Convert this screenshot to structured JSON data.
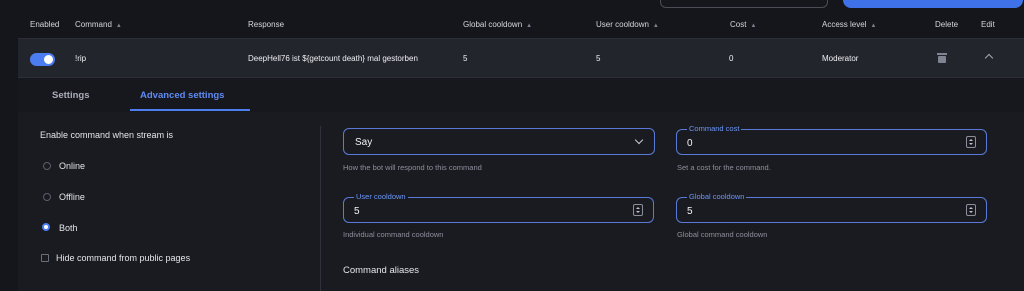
{
  "header": {
    "enabled": "Enabled",
    "command": "Command",
    "response": "Response",
    "global_cooldown": "Global cooldown",
    "user_cooldown": "User cooldown",
    "cost": "Cost",
    "access_level": "Access level",
    "delete": "Delete",
    "edit": "Edit",
    "sort_icon": "▲"
  },
  "row": {
    "enabled": true,
    "command": "!rip",
    "response": "DeepHell76 ist ${getcount death} mal gestorben",
    "global_cooldown": "5",
    "user_cooldown": "5",
    "cost": "0",
    "access_level": "Moderator",
    "delete_icon": "trash-icon",
    "edit_icon": "chevron-up-icon"
  },
  "tabs": {
    "settings": "Settings",
    "advanced": "Advanced settings"
  },
  "advanced": {
    "stream_status_label": "Enable command when stream is",
    "options": [
      {
        "label": "Online",
        "selected": false
      },
      {
        "label": "Offline",
        "selected": false
      },
      {
        "label": "Both",
        "selected": true
      }
    ],
    "hide_label": "Hide command from public pages",
    "hide_checked": false,
    "response_type": {
      "value": "Say",
      "hint": "How the bot will respond to this command"
    },
    "command_cost": {
      "label": "Command cost",
      "value": "0",
      "hint": "Set a cost for the command."
    },
    "user_cooldown": {
      "label": "User cooldown",
      "value": "5",
      "hint": "Individual command cooldown"
    },
    "global_cooldown": {
      "label": "Global cooldown",
      "value": "5",
      "hint": "Global command cooldown"
    },
    "aliases_title": "Command aliases"
  },
  "colors": {
    "accent": "#4d7ef0",
    "background": "#15161b",
    "row": "#23252d"
  }
}
